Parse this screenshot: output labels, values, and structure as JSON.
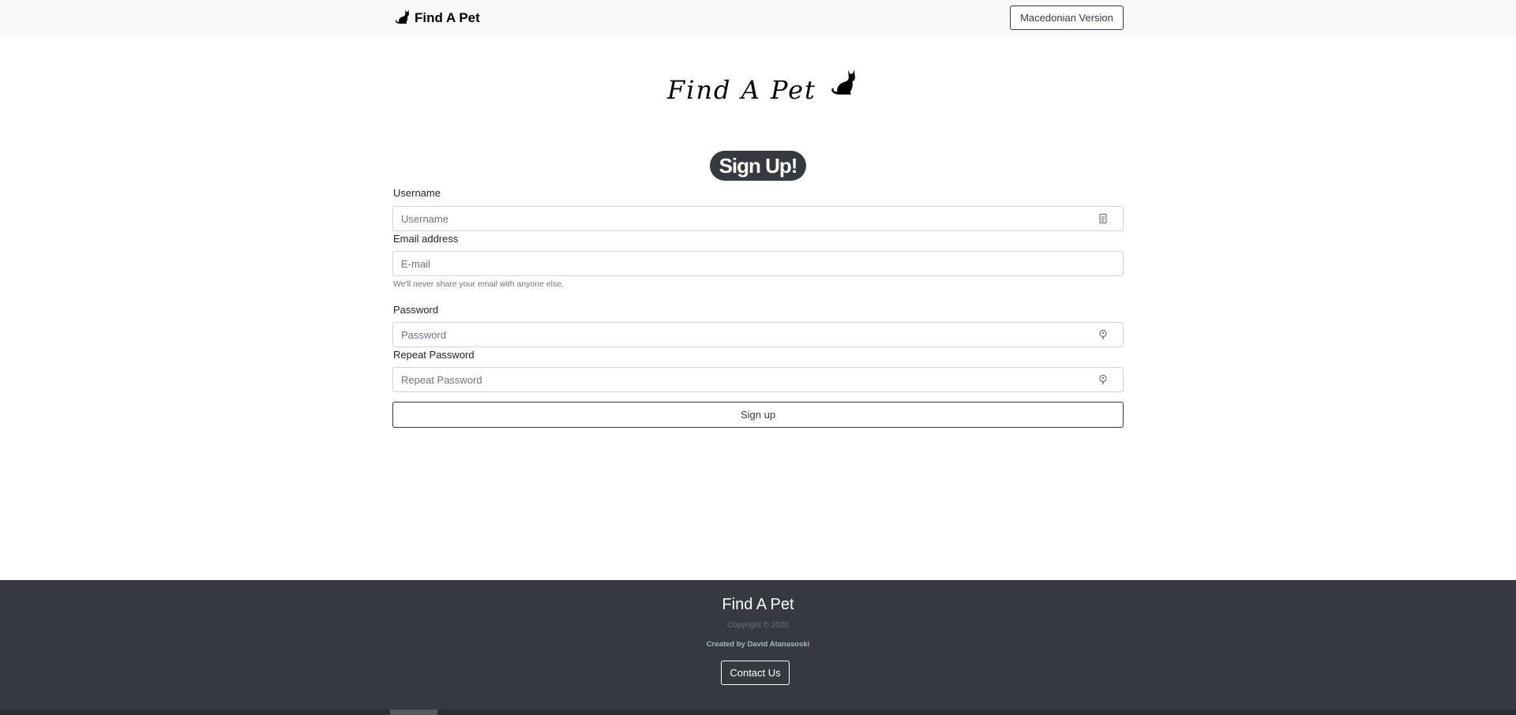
{
  "navbar": {
    "brand": "Find A Pet",
    "brand_icon": "cat-icon",
    "language_button": "Macedonian Version"
  },
  "logo": {
    "text": "Find A Pet",
    "icon": "cat-icon"
  },
  "form": {
    "heading": "Sign Up!",
    "username": {
      "label": "Username",
      "placeholder": "Username",
      "value": "",
      "icon": "id-card-icon"
    },
    "email": {
      "label": "Email address",
      "placeholder": "E-mail",
      "value": "",
      "help": "We'll never share your email with anyone else."
    },
    "password": {
      "label": "Password",
      "placeholder": "Password",
      "value": "",
      "icon": "key-icon"
    },
    "repeat_password": {
      "label": "Repeat Password",
      "placeholder": "Repeat Password",
      "value": "",
      "icon": "key-icon"
    },
    "submit_label": "Sign up"
  },
  "footer": {
    "title": "Find A Pet",
    "copyright": "Copyright © 2020",
    "creator": "Created by David Atanasoski",
    "contact_label": "Contact Us"
  },
  "colors": {
    "navbar_bg": "#f8f9fa",
    "dark": "#343a40",
    "border": "#ced4da",
    "muted": "#6c757d"
  }
}
